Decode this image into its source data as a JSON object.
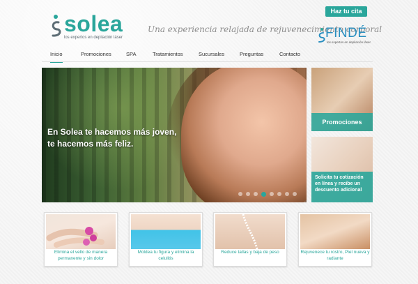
{
  "brand": {
    "name": "solea",
    "subtitle": "los expertos en depilación láser"
  },
  "header": {
    "tagline": "Una experiencia relajada de rejuvenecimiento corporal",
    "cta_label": "Haz tu cita",
    "partner_name": "FINDÉ",
    "partner_subtitle": "los expertos en depilación láser"
  },
  "nav": {
    "items": [
      "Inicio",
      "Promociones",
      "SPA",
      "Tratamientos",
      "Sucursales",
      "Preguntas",
      "Contacto"
    ]
  },
  "hero": {
    "line1": "En Solea te hacemos más joven,",
    "line2": "te hacemos más feliz.",
    "dots_total": 8,
    "active_dot": 4
  },
  "side": {
    "promo_label": "Promociones",
    "quote_label": "Solicita tu cotización en línea y recibe un descuento adicional"
  },
  "cards": [
    "Elimina el vello de manera permanente y sin dolor",
    "Moldea tu figura y elimina la celulitis",
    "Reduce tallas y baja de peso",
    "Rejuvenece tu rostro, Piel nueva y radiante"
  ],
  "colors": {
    "accent": "#2aa69b",
    "partner": "#2a8fc0"
  }
}
